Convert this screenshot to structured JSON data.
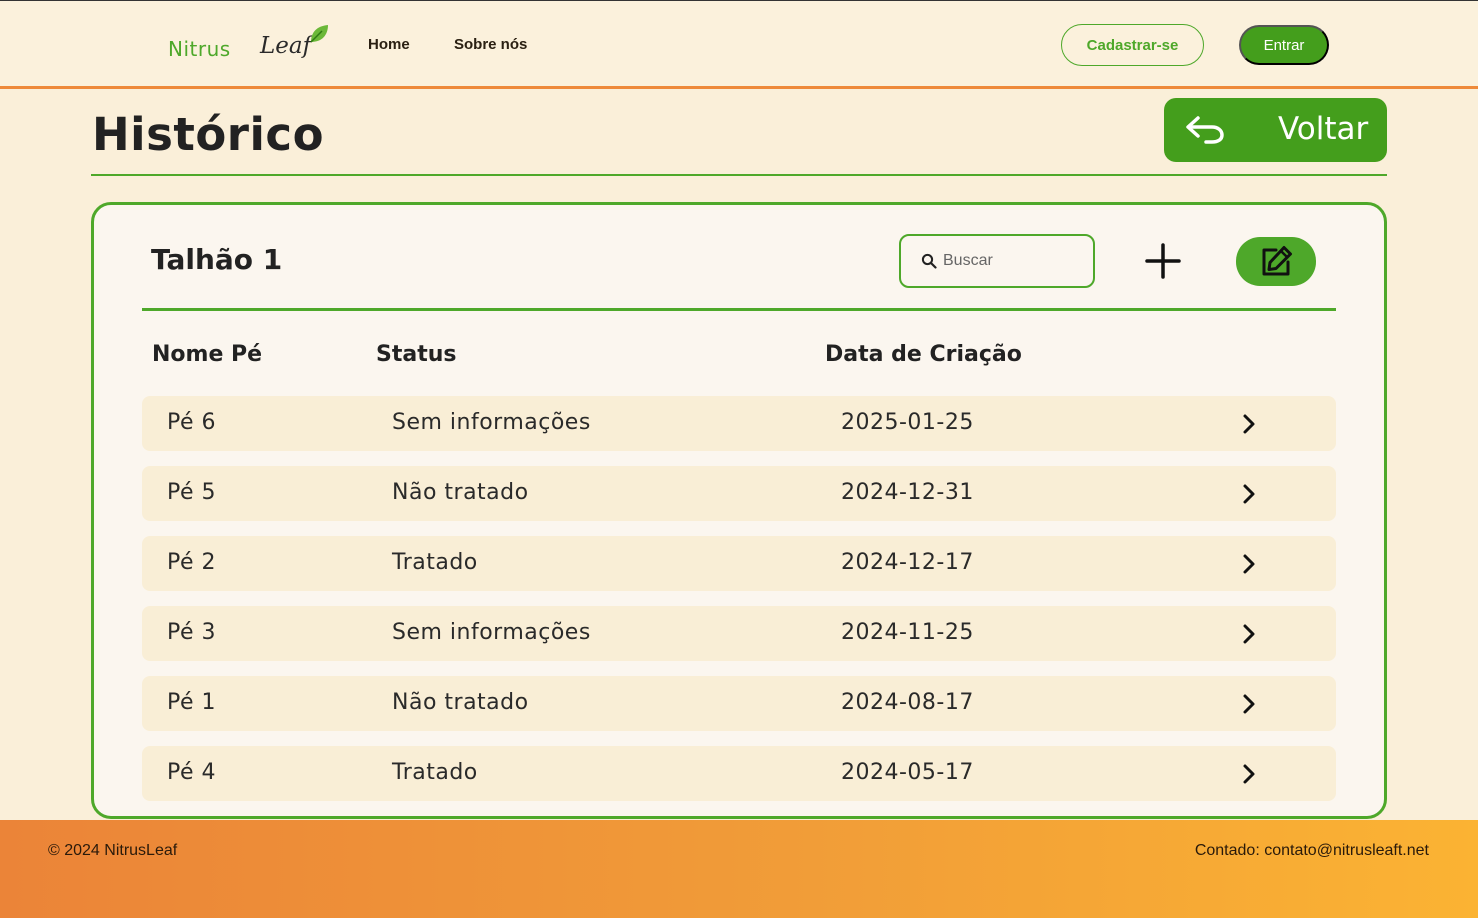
{
  "brand": {
    "name_part1": "Nitrus",
    "name_part2": "Leaf"
  },
  "nav": {
    "home": "Home",
    "about": "Sobre nós"
  },
  "auth": {
    "signup": "Cadastrar-se",
    "login": "Entrar"
  },
  "page": {
    "title": "Histórico",
    "back_label": "Voltar"
  },
  "card": {
    "title": "Talhão 1",
    "search_placeholder": "Buscar",
    "columns": [
      "Nome Pé",
      "Status",
      "Data de Criação"
    ],
    "rows": [
      {
        "name": "Pé 6",
        "status": "Sem informações",
        "date": "2025-01-25"
      },
      {
        "name": "Pé 5",
        "status": "Não tratado",
        "date": "2024-12-31"
      },
      {
        "name": "Pé 2",
        "status": "Tratado",
        "date": "2024-12-17"
      },
      {
        "name": "Pé 3",
        "status": "Sem informações",
        "date": "2024-11-25"
      },
      {
        "name": "Pé 1",
        "status": "Não tratado",
        "date": "2024-08-17"
      },
      {
        "name": "Pé 4",
        "status": "Tratado",
        "date": "2024-05-17"
      }
    ]
  },
  "footer": {
    "copyright": "© 2024 NitrusLeaf",
    "contact": "Contado: contato@nitrusleaft.net"
  },
  "colors": {
    "primary_green": "#449e1c",
    "accent_orange": "#ee8a3a",
    "background": "#faefd9"
  },
  "icons": {
    "back": "undo-arrow-icon",
    "search": "search-icon",
    "add": "plus-icon",
    "edit": "edit-icon",
    "row": "chevron-right-icon"
  }
}
